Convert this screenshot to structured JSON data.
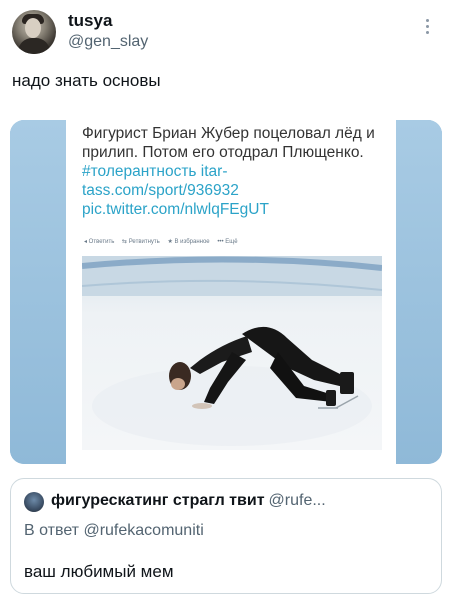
{
  "header": {
    "display_name": "tusya",
    "handle": "@gen_slay",
    "more_icon": "more-vertical-icon"
  },
  "tweet": {
    "text": "надо знать основы"
  },
  "embedded_tweet": {
    "text_main": "Фигурист Бриан Жубер поцеловал лёд и прилип. Потом его отодрал Плющенко. ",
    "hashtag": "#толерантность",
    "link1": " itar-tass.com/sport/936932",
    "link2": "pic.twitter.com/nlwlqFEgUT",
    "actions": [
      "◂ Ответить",
      "⇆ Ретвитнуть",
      "★ В избранное",
      "••• Ещё"
    ]
  },
  "quote": {
    "name": "фигурескатинг страгл твит",
    "handle": "@rufe...",
    "reply_to": "В ответ @rufekacomuniti",
    "text": "ваш любимый мем"
  }
}
